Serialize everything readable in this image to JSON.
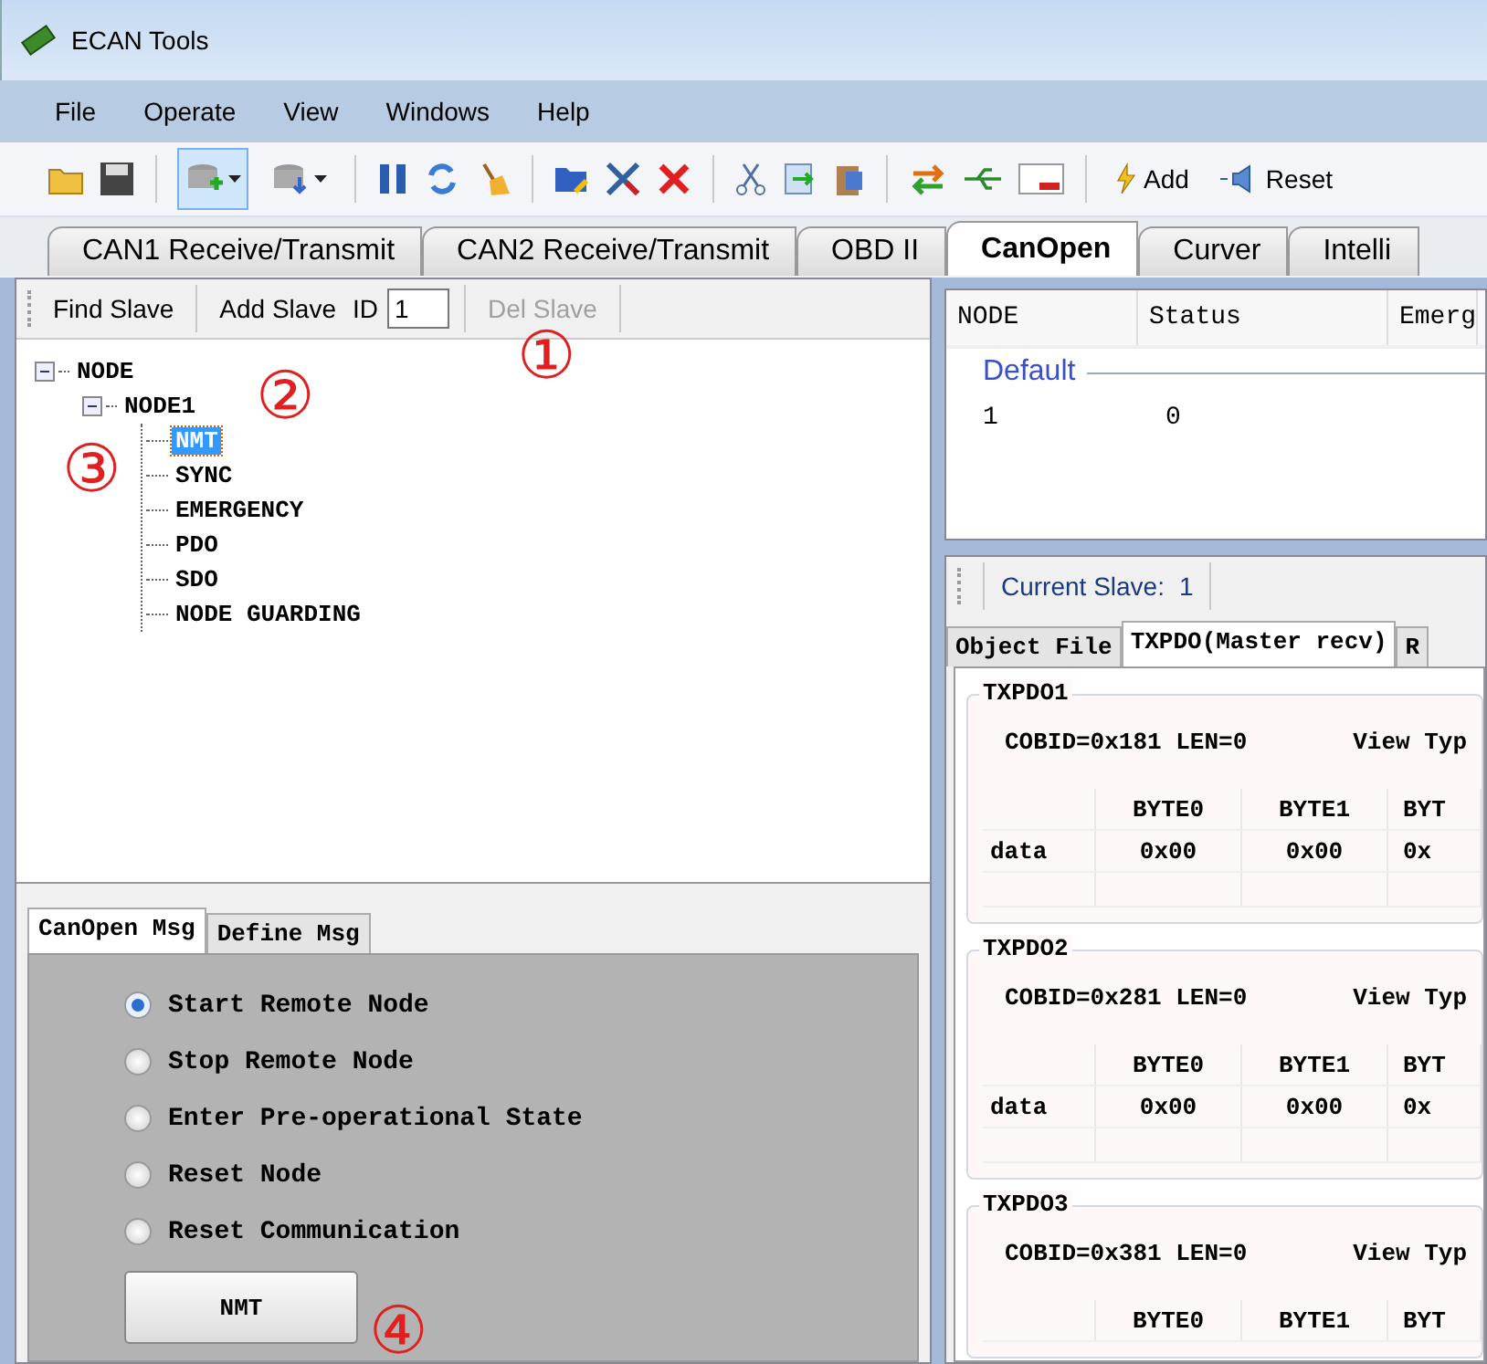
{
  "window": {
    "title": "ECAN Tools"
  },
  "menu": [
    "File",
    "Operate",
    "View",
    "Windows",
    "Help"
  ],
  "toolbar": {
    "add_label": "Add",
    "reset_label": "Reset"
  },
  "tabs": [
    {
      "label": "CAN1 Receive/Transmit",
      "selected": false
    },
    {
      "label": "CAN2 Receive/Transmit",
      "selected": false
    },
    {
      "label": "OBD II",
      "selected": false
    },
    {
      "label": "CanOpen",
      "selected": true
    },
    {
      "label": "Curver",
      "selected": false
    },
    {
      "label": "Intelli",
      "selected": false
    }
  ],
  "slave_toolbar": {
    "find": "Find Slave",
    "add": "Add Slave",
    "id_label": "ID",
    "id_value": "1",
    "delete": "Del Slave",
    "delete_disabled": true
  },
  "tree": [
    {
      "label": "NODE",
      "expanded": true,
      "selected": false,
      "children": [
        {
          "label": "NODE1",
          "expanded": true,
          "selected": false,
          "children": [
            {
              "label": "NMT",
              "selected": true
            },
            {
              "label": "SYNC",
              "selected": false
            },
            {
              "label": "EMERGENCY",
              "selected": false
            },
            {
              "label": "PDO",
              "selected": false
            },
            {
              "label": "SDO",
              "selected": false
            },
            {
              "label": "NODE GUARDING",
              "selected": false
            }
          ]
        }
      ]
    }
  ],
  "msg_tabs": [
    {
      "label": "CanOpen Msg",
      "selected": true
    },
    {
      "label": "Define Msg",
      "selected": false
    }
  ],
  "nmt_options": [
    {
      "label": "Start Remote Node",
      "selected": true
    },
    {
      "label": "Stop Remote Node",
      "selected": false
    },
    {
      "label": "Enter Pre-operational State",
      "selected": false
    },
    {
      "label": "Reset Node",
      "selected": false
    },
    {
      "label": "Reset Communication",
      "selected": false
    }
  ],
  "nmt_button": "NMT",
  "node_table": {
    "columns": [
      "NODE",
      "Status",
      "Emerg"
    ],
    "group": "Default",
    "rows": [
      [
        "1",
        "0"
      ]
    ]
  },
  "current_slave": {
    "label": "Current Slave:",
    "value": "1"
  },
  "slave_tabs": [
    {
      "label": "Object File",
      "selected": false
    },
    {
      "label": "TXPDO(Master recv)",
      "selected": true
    },
    {
      "label": "R",
      "selected": false
    }
  ],
  "pdos": [
    {
      "title": "TXPDO1",
      "info": "COBID=0x181 LEN=0",
      "view_type": "View Typ",
      "columns": [
        "",
        "BYTE0",
        "BYTE1",
        "BYT"
      ],
      "rows": [
        [
          "data",
          "0x00",
          "0x00",
          "0x"
        ]
      ]
    },
    {
      "title": "TXPDO2",
      "info": "COBID=0x281 LEN=0",
      "view_type": "View Typ",
      "columns": [
        "",
        "BYTE0",
        "BYTE1",
        "BYT"
      ],
      "rows": [
        [
          "data",
          "0x00",
          "0x00",
          "0x"
        ]
      ]
    },
    {
      "title": "TXPDO3",
      "info": "COBID=0x381 LEN=0",
      "view_type": "View Typ",
      "columns": [
        "",
        "BYTE0",
        "BYTE1",
        "BYT"
      ]
    }
  ],
  "annotations": [
    "①",
    "②",
    "③",
    "④"
  ]
}
